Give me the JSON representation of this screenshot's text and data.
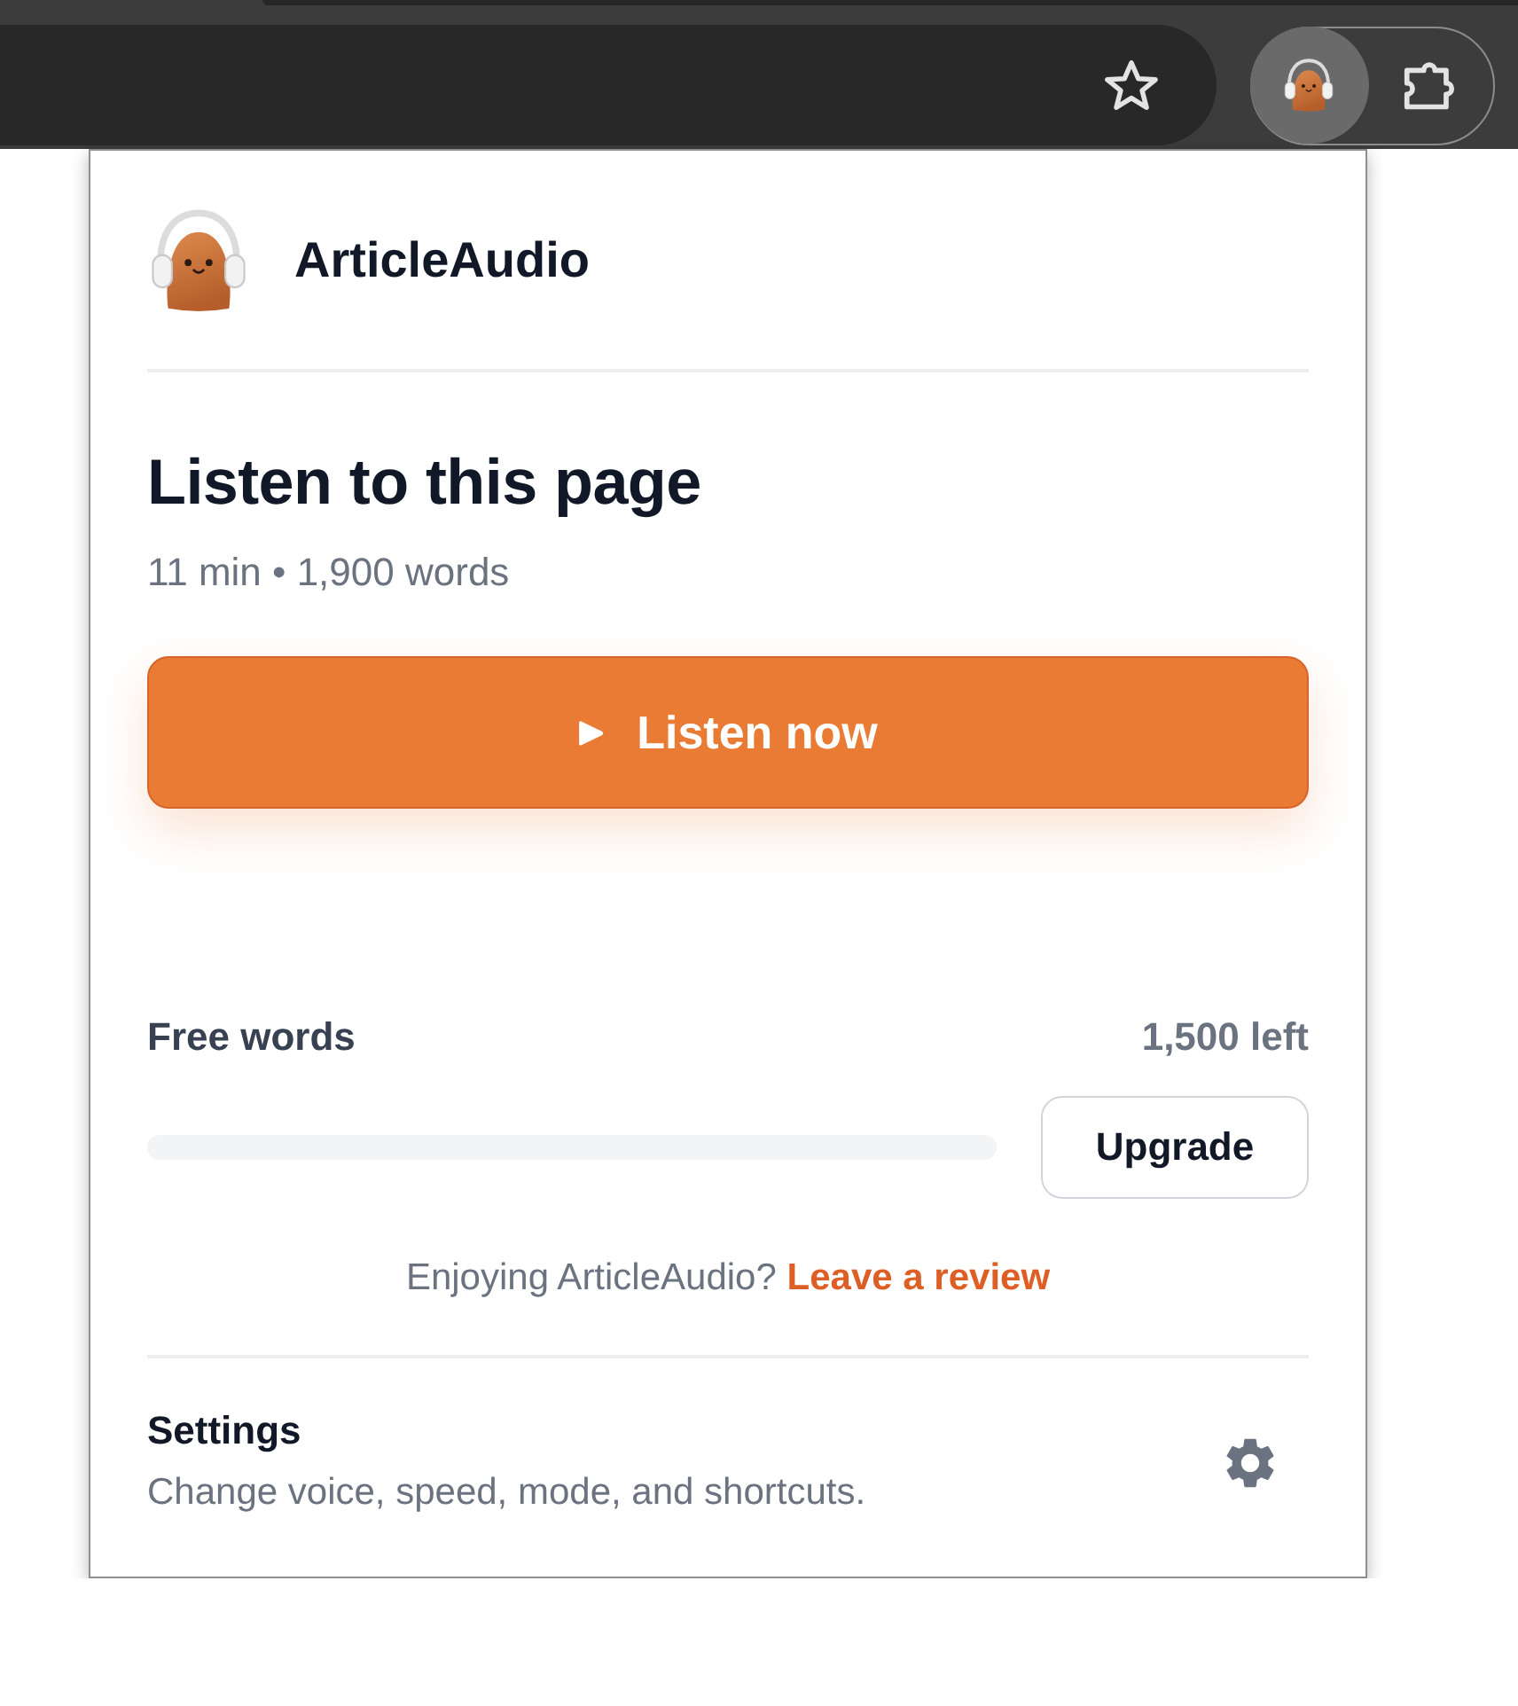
{
  "toolbar": {
    "buttons": [
      {
        "kind": "extension",
        "selected": true
      },
      {
        "kind": "extensions_menu",
        "selected": false
      }
    ]
  },
  "popup": {
    "brand": "ArticleAudio",
    "heading": "Listen to this page",
    "meta": "11 min • 1,900 words",
    "primary_button": "Listen now",
    "usage": {
      "label": "Free words",
      "reading": "1,500 left",
      "button": "Upgrade"
    },
    "review": {
      "text": "Enjoying ArticleAudio?",
      "link": "Leave a review"
    },
    "settings": {
      "title": "Settings",
      "description": "Change voice, speed, mode, and shortcuts."
    }
  }
}
